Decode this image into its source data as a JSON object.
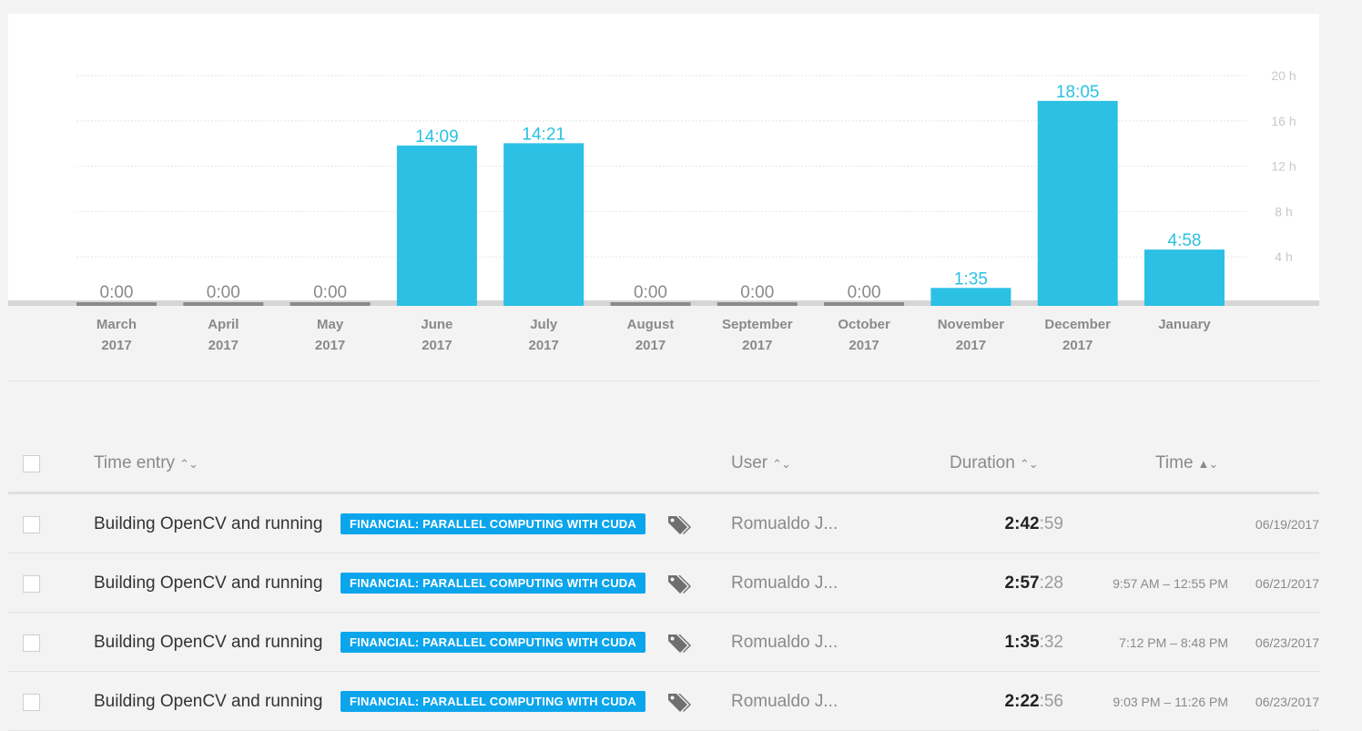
{
  "chart_data": {
    "type": "bar",
    "categories": [
      [
        "March",
        "2017"
      ],
      [
        "April",
        "2017"
      ],
      [
        "May",
        "2017"
      ],
      [
        "June",
        "2017"
      ],
      [
        "July",
        "2017"
      ],
      [
        "August",
        "2017"
      ],
      [
        "September",
        "2017"
      ],
      [
        "October",
        "2017"
      ],
      [
        "November",
        "2017"
      ],
      [
        "December",
        "2017"
      ],
      [
        "January",
        ""
      ]
    ],
    "values": [
      0,
      0,
      0,
      14.15,
      14.35,
      0,
      0,
      0,
      1.583,
      18.083,
      4.967
    ],
    "value_labels": [
      "0:00",
      "0:00",
      "0:00",
      "14:09",
      "14:21",
      "0:00",
      "0:00",
      "0:00",
      "1:35",
      "18:05",
      "4:58"
    ],
    "y_ticks": [
      4,
      8,
      12,
      16,
      20
    ],
    "y_tick_labels": [
      "4 h",
      "8 h",
      "12 h",
      "16 h",
      "20 h"
    ],
    "ylim": [
      0,
      20
    ],
    "grid": true,
    "colors": {
      "bar": "#2bc0e4",
      "empty_bar": "#8a8a8a",
      "active_label": "#2bc0e4",
      "empty_label": "#8a8a8a",
      "tick_label": "#c8c8c8"
    }
  },
  "table": {
    "headers": {
      "time_entry": "Time entry",
      "user": "User",
      "duration": "Duration",
      "time": "Time"
    },
    "rows": [
      {
        "description": "Building OpenCV and running",
        "project": "FINANCIAL: PARALLEL COMPUTING WITH CUDA",
        "user": "Romualdo J...",
        "duration_hm": "2:42",
        "duration_s": ":59",
        "range": "",
        "date": "06/19/2017"
      },
      {
        "description": "Building OpenCV and running",
        "project": "FINANCIAL: PARALLEL COMPUTING WITH CUDA",
        "user": "Romualdo J...",
        "duration_hm": "2:57",
        "duration_s": ":28",
        "range": "9:57 AM – 12:55 PM",
        "date": "06/21/2017"
      },
      {
        "description": "Building OpenCV and running",
        "project": "FINANCIAL: PARALLEL COMPUTING WITH CUDA",
        "user": "Romualdo J...",
        "duration_hm": "1:35",
        "duration_s": ":32",
        "range": "7:12 PM – 8:48 PM",
        "date": "06/23/2017"
      },
      {
        "description": "Building OpenCV and running",
        "project": "FINANCIAL: PARALLEL COMPUTING WITH CUDA",
        "user": "Romualdo J...",
        "duration_hm": "2:22",
        "duration_s": ":56",
        "range": "9:03 PM – 11:26 PM",
        "date": "06/23/2017"
      }
    ]
  },
  "icons": {
    "tag": "tag-icon",
    "checkbox": "checkbox-icon"
  },
  "colors": {
    "project_badge": "#0ba5ec"
  }
}
